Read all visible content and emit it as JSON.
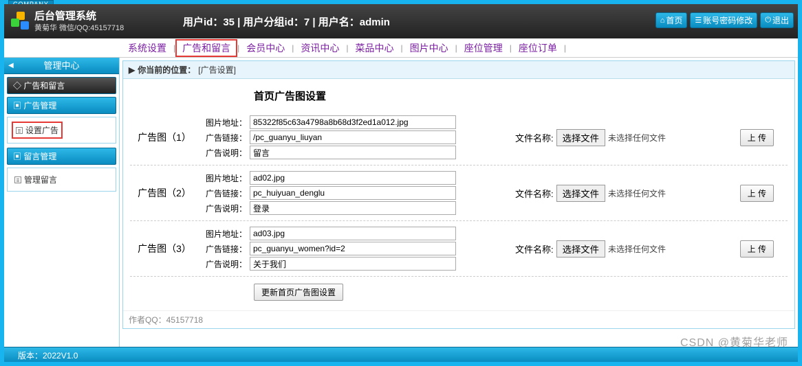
{
  "brand_tag": "COMPANY",
  "logo": {
    "title": "后台管理系统",
    "subtitle": "黄菊华 微信/QQ:45157718"
  },
  "header_info": "用户id：35 | 用户分组id：7 | 用户名：admin",
  "header_buttons": {
    "home": "首页",
    "pwd": "账号密码修改",
    "logout": "退出"
  },
  "topnav": {
    "items": [
      "系统设置",
      "广告和留言",
      "会员中心",
      "资讯中心",
      "菜品中心",
      "图片中心",
      "座位管理",
      "座位订单"
    ],
    "active_index": 1
  },
  "sidebar": {
    "center_title": "管理中心",
    "section_active": "广告和留言",
    "group1": {
      "title": "广告管理",
      "item": "设置广告"
    },
    "group2": {
      "title": "留言管理",
      "item": "管理留言"
    }
  },
  "breadcrumb": {
    "prefix": "你当前的位置：",
    "location": "[广告设置]"
  },
  "form": {
    "title": "首页广告图设置",
    "labels": {
      "img": "图片地址：",
      "link": "广告链接：",
      "desc": "广告说明：",
      "filename": "文件名称:",
      "choose": "选择文件",
      "nofile": "未选择任何文件",
      "upload": "上 传"
    },
    "ads": [
      {
        "name": "广告图（1）",
        "img": "85322f85c63a4798a8b68d3f2ed1a012.jpg",
        "link": "/pc_guanyu_liuyan",
        "desc": "留言"
      },
      {
        "name": "广告图（2）",
        "img": "ad02.jpg",
        "link": "pc_huiyuan_denglu",
        "desc": "登录"
      },
      {
        "name": "广告图（3）",
        "img": "ad03.jpg",
        "link": "pc_guanyu_women?id=2",
        "desc": "关于我们"
      }
    ],
    "submit": "更新首页广告图设置"
  },
  "footer_note": "作者QQ：45157718",
  "version": "版本：2022V1.0",
  "watermark": "CSDN @黄菊华老师"
}
